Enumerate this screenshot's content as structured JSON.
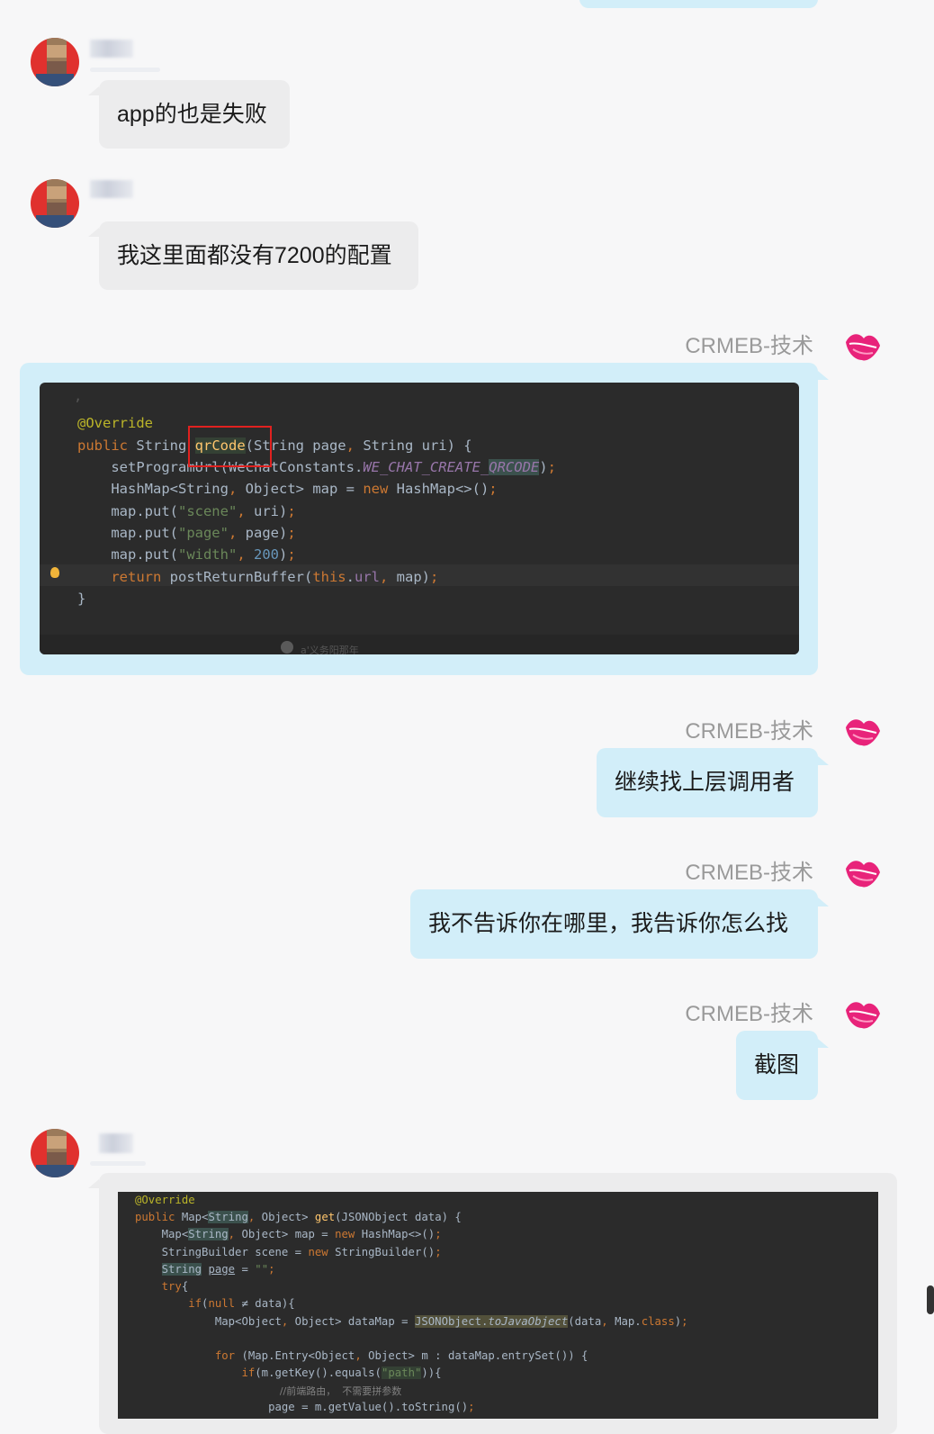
{
  "messages": {
    "m1": {
      "text": "app的也是失败"
    },
    "m2": {
      "text": "我这里面都没有7200的配置"
    },
    "m3": {
      "sender": "CRMEB-技术"
    },
    "m4": {
      "sender": "CRMEB-技术",
      "text": "继续找上层调用者"
    },
    "m5": {
      "sender": "CRMEB-技术",
      "text": "我不告诉你在哪里，我告诉你怎么找"
    },
    "m6": {
      "sender": "CRMEB-技术",
      "text": "截图"
    }
  },
  "code1": {
    "overlay_text": "a'义务阳那年"
  },
  "code2": {}
}
